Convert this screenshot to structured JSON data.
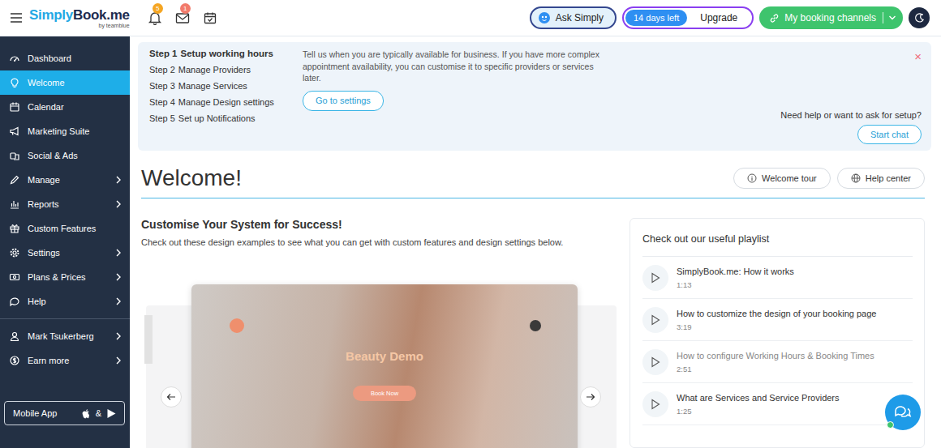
{
  "topbar": {
    "logo": {
      "first": "Simply",
      "second": "Book.me",
      "sub": "by teamblue"
    },
    "notifications": [
      {
        "kind": "bell",
        "badge": "5",
        "color": "#f5a623"
      },
      {
        "kind": "mail",
        "badge": "1",
        "color": "#f27b6b"
      }
    ],
    "ask_button": "Ask Simply",
    "trial": "14 days left",
    "upgrade": "Upgrade",
    "channels_button": "My booking channels"
  },
  "sidebar": {
    "items": [
      {
        "label": "Dashboard",
        "selected": false,
        "expandable": false
      },
      {
        "label": "Welcome",
        "selected": true,
        "expandable": false
      },
      {
        "label": "Calendar",
        "selected": false,
        "expandable": false
      },
      {
        "label": "Marketing Suite",
        "selected": false,
        "expandable": false
      },
      {
        "label": "Social & Ads",
        "selected": false,
        "expandable": false
      },
      {
        "label": "Manage",
        "selected": false,
        "expandable": true
      },
      {
        "label": "Reports",
        "selected": false,
        "expandable": true
      },
      {
        "label": "Custom Features",
        "selected": false,
        "expandable": false
      },
      {
        "label": "Settings",
        "selected": false,
        "expandable": true
      },
      {
        "label": "Plans & Prices",
        "selected": false,
        "expandable": true
      },
      {
        "label": "Help",
        "selected": false,
        "expandable": true
      }
    ],
    "account_items": [
      {
        "label": "Mark Tsukerberg",
        "selected": false,
        "expandable": true
      },
      {
        "label": "Earn more",
        "selected": false,
        "expandable": true
      }
    ],
    "mobile_app": {
      "label": "Mobile App",
      "amp": "&"
    }
  },
  "onboarding": {
    "steps": [
      {
        "number": "Step 1",
        "label": "Setup working hours",
        "selected": true
      },
      {
        "number": "Step 2",
        "label": "Manage Providers",
        "selected": false
      },
      {
        "number": "Step 3",
        "label": "Manage Services",
        "selected": false
      },
      {
        "number": "Step 4",
        "label": "Manage Design settings",
        "selected": false
      },
      {
        "number": "Step 5",
        "label": "Set up Notifications",
        "selected": false
      }
    ],
    "description": "Tell us when you are typically available for business. If you have more complex appointment availability, you can customise it to specific providers or services later.",
    "button": "Go to settings",
    "close": "×",
    "help_text": "Need help or want to ask for setup?",
    "chat_button": "Start chat"
  },
  "header": {
    "title": "Welcome!",
    "buttons": [
      "Welcome tour",
      "Help center"
    ]
  },
  "customise": {
    "title": "Customise Your System for Success!",
    "subtitle": "Check out these design examples to see what you can get with custom features and design settings below.",
    "slide": {
      "title": "Beauty Demo",
      "button": "Book Now"
    }
  },
  "playlist": {
    "title": "Check out our useful playlist",
    "videos": [
      {
        "title": "SimplyBook.me: How it works",
        "duration": "1:13",
        "dimmed": false
      },
      {
        "title": "How to customize the design of your booking page",
        "duration": "3:19",
        "dimmed": false
      },
      {
        "title": "How to configure Working Hours & Booking Times",
        "duration": "2:51",
        "dimmed": true
      },
      {
        "title": "What are Services and Service Providers",
        "duration": "1:25",
        "dimmed": false
      }
    ]
  }
}
